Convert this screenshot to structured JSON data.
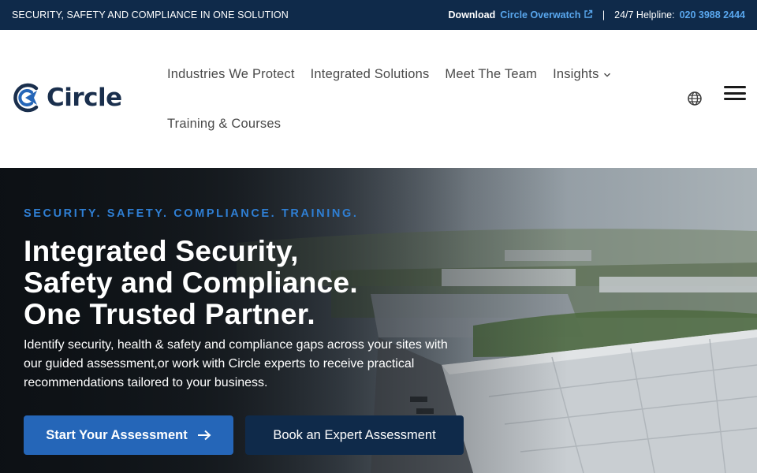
{
  "topbar": {
    "tagline": "SECURITY, SAFETY AND COMPLIANCE IN ONE SOLUTION",
    "download_label": "Download",
    "download_link": "Circle Overwatch",
    "separator": "|",
    "helpline_label": "24/7 Helpline:",
    "helpline_number": "020 3988 2444"
  },
  "logo": {
    "text": "Circle",
    "brand_color": "#1a2f4d",
    "accent_color": "#2566b8"
  },
  "nav": {
    "items": [
      {
        "label": "Industries We Protect"
      },
      {
        "label": "Integrated Solutions"
      },
      {
        "label": "Meet The Team"
      },
      {
        "label": "Insights",
        "has_dropdown": true
      }
    ],
    "second_row": [
      {
        "label": "Training & Courses"
      }
    ],
    "language_icon": "globe-icon",
    "menu_icon": "hamburger-icon"
  },
  "hero": {
    "eyebrow": "SECURITY. SAFETY. COMPLIANCE. TRAINING.",
    "headline": [
      "Integrated Security,",
      "Safety and Compliance.",
      "One Trusted Partner."
    ],
    "description": "Identify security, health & safety and compliance gaps across your sites with our guided assessment,or work with Circle experts to receive practical recommendations tailored to your business.",
    "primary_button": "Start Your Assessment",
    "secondary_button": "Book an Expert Assessment",
    "eyebrow_color": "#2f7fd4",
    "primary_color": "#2566b8",
    "secondary_color": "#0f2a4a"
  }
}
